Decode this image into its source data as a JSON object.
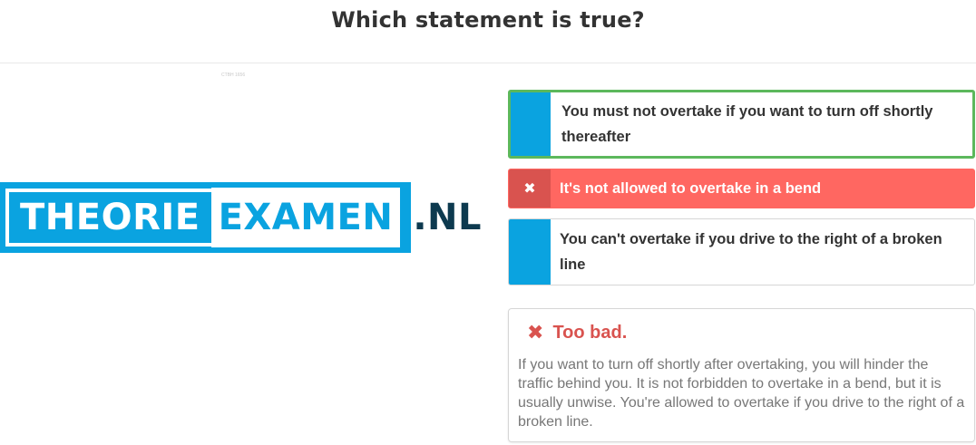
{
  "question": {
    "title": "Which statement is true?"
  },
  "image": {
    "credit": "CTBH 1656",
    "logo": {
      "word1": "THEORIE",
      "word2": "EXAMEN",
      "tld": ".NL",
      "colors": {
        "blue": "#0aa3e0",
        "dark": "#0d3a4f"
      }
    }
  },
  "answers": [
    {
      "text": "You must not overtake if you want to turn off shortly thereafter",
      "state": "correct",
      "border_color": "#5cb85c"
    },
    {
      "text": "It's not allowed to overtake in a bend",
      "state": "wrong-selected",
      "icon": "x-icon",
      "background": "#ff6761"
    },
    {
      "text": "You can't overtake if you drive to the right of a broken line",
      "state": "neutral"
    }
  ],
  "feedback": {
    "icon": "x-icon",
    "title": "Too bad.",
    "title_color": "#d9534f",
    "body": "If you want to turn off shortly after overtaking, you will hinder the traffic behind you. It is not forbidden to overtake in a bend, but it is usually unwise. You're allowed to overtake if you drive to the right of a broken line."
  }
}
